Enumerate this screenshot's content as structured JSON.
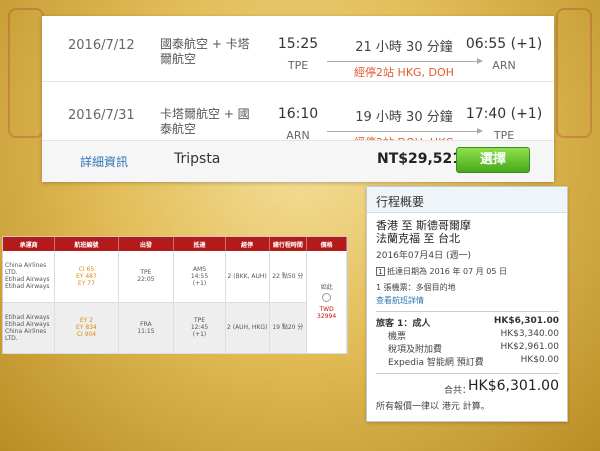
{
  "flights": [
    {
      "date": "2016/7/12",
      "airline": "國泰航空 + 卡塔爾航空",
      "dep_time": "15:25",
      "dep_code": "TPE",
      "duration": "21 小時 30 分鐘",
      "stops": "經停2站 HKG, DOH",
      "arr_time": "06:55 (+1)",
      "arr_code": "ARN"
    },
    {
      "date": "2016/7/31",
      "airline": "卡塔爾航空 + 國泰航空",
      "dep_time": "16:10",
      "dep_code": "ARN",
      "duration": "19 小時 30 分鐘",
      "stops": "經停2站 DOH, HKG",
      "arr_time": "17:40 (+1)",
      "arr_code": "TPE"
    }
  ],
  "card_footer": {
    "detail_link": "詳細資訊",
    "provider": "Tripsta",
    "price": "NT$29,521",
    "select_button": "選擇"
  },
  "itinerary": {
    "header": "行程概要",
    "route": "香港 至 斯德哥爾摩\n法蘭克福 至 台北",
    "date": "2016年07月4日 (週一)",
    "return_note_icon": "1",
    "return_note": "抵達日期為 2016 年 07 月 05 日",
    "ticket_line": "1 張機票：多個目的地",
    "view_link": "查看航班詳情",
    "traveler_label": "旅客 1：成人",
    "traveler_price": "HK$6,301.00",
    "ticket_label": "機票",
    "ticket_price": "HK$3,340.00",
    "tax_label": "稅項及附加費",
    "tax_price": "HK$2,961.00",
    "booking_fee_label": "Expedia 智能網 預訂費",
    "booking_fee_price": "HK$0.00",
    "total_label": "合共：",
    "total_price": "HK$6,301.00",
    "note": "所有報價一律以 港元 計算。"
  },
  "fare_table": {
    "headers": [
      "承運商",
      "航班編號",
      "出發",
      "抵達",
      "經停",
      "總行程時間",
      "價格"
    ],
    "rows": [
      {
        "carriers": [
          "China Airlines LTD.",
          "Etihad Airways",
          "Etihad Airways"
        ],
        "flights": [
          "CI 65",
          "EY 487",
          "EY 77"
        ],
        "depart": "TPE\n22:05",
        "arrive": "AMS\n14:55\n(+1)",
        "stops": "2 (BKK, AUH)",
        "duration": "22 點50 分"
      },
      {
        "carriers": [
          "Etihad Airways",
          "Etihad Airways",
          "China Airlines LTD."
        ],
        "flights": [
          "EY 2",
          "EY 834",
          "CI 904"
        ],
        "depart": "FRA\n11:15",
        "arrive": "TPE\n12:45\n(+1)",
        "stops": "2 (AUH, HKG)",
        "duration": "19 點20 分"
      }
    ],
    "price_caption": "如此",
    "price_label": "TWD",
    "price_value": "32994"
  },
  "colors": {
    "fare_header": "#b31b1b",
    "stops_red": "#e05a2a",
    "select_green": "#46a81c",
    "link_blue": "#2e78b6"
  }
}
